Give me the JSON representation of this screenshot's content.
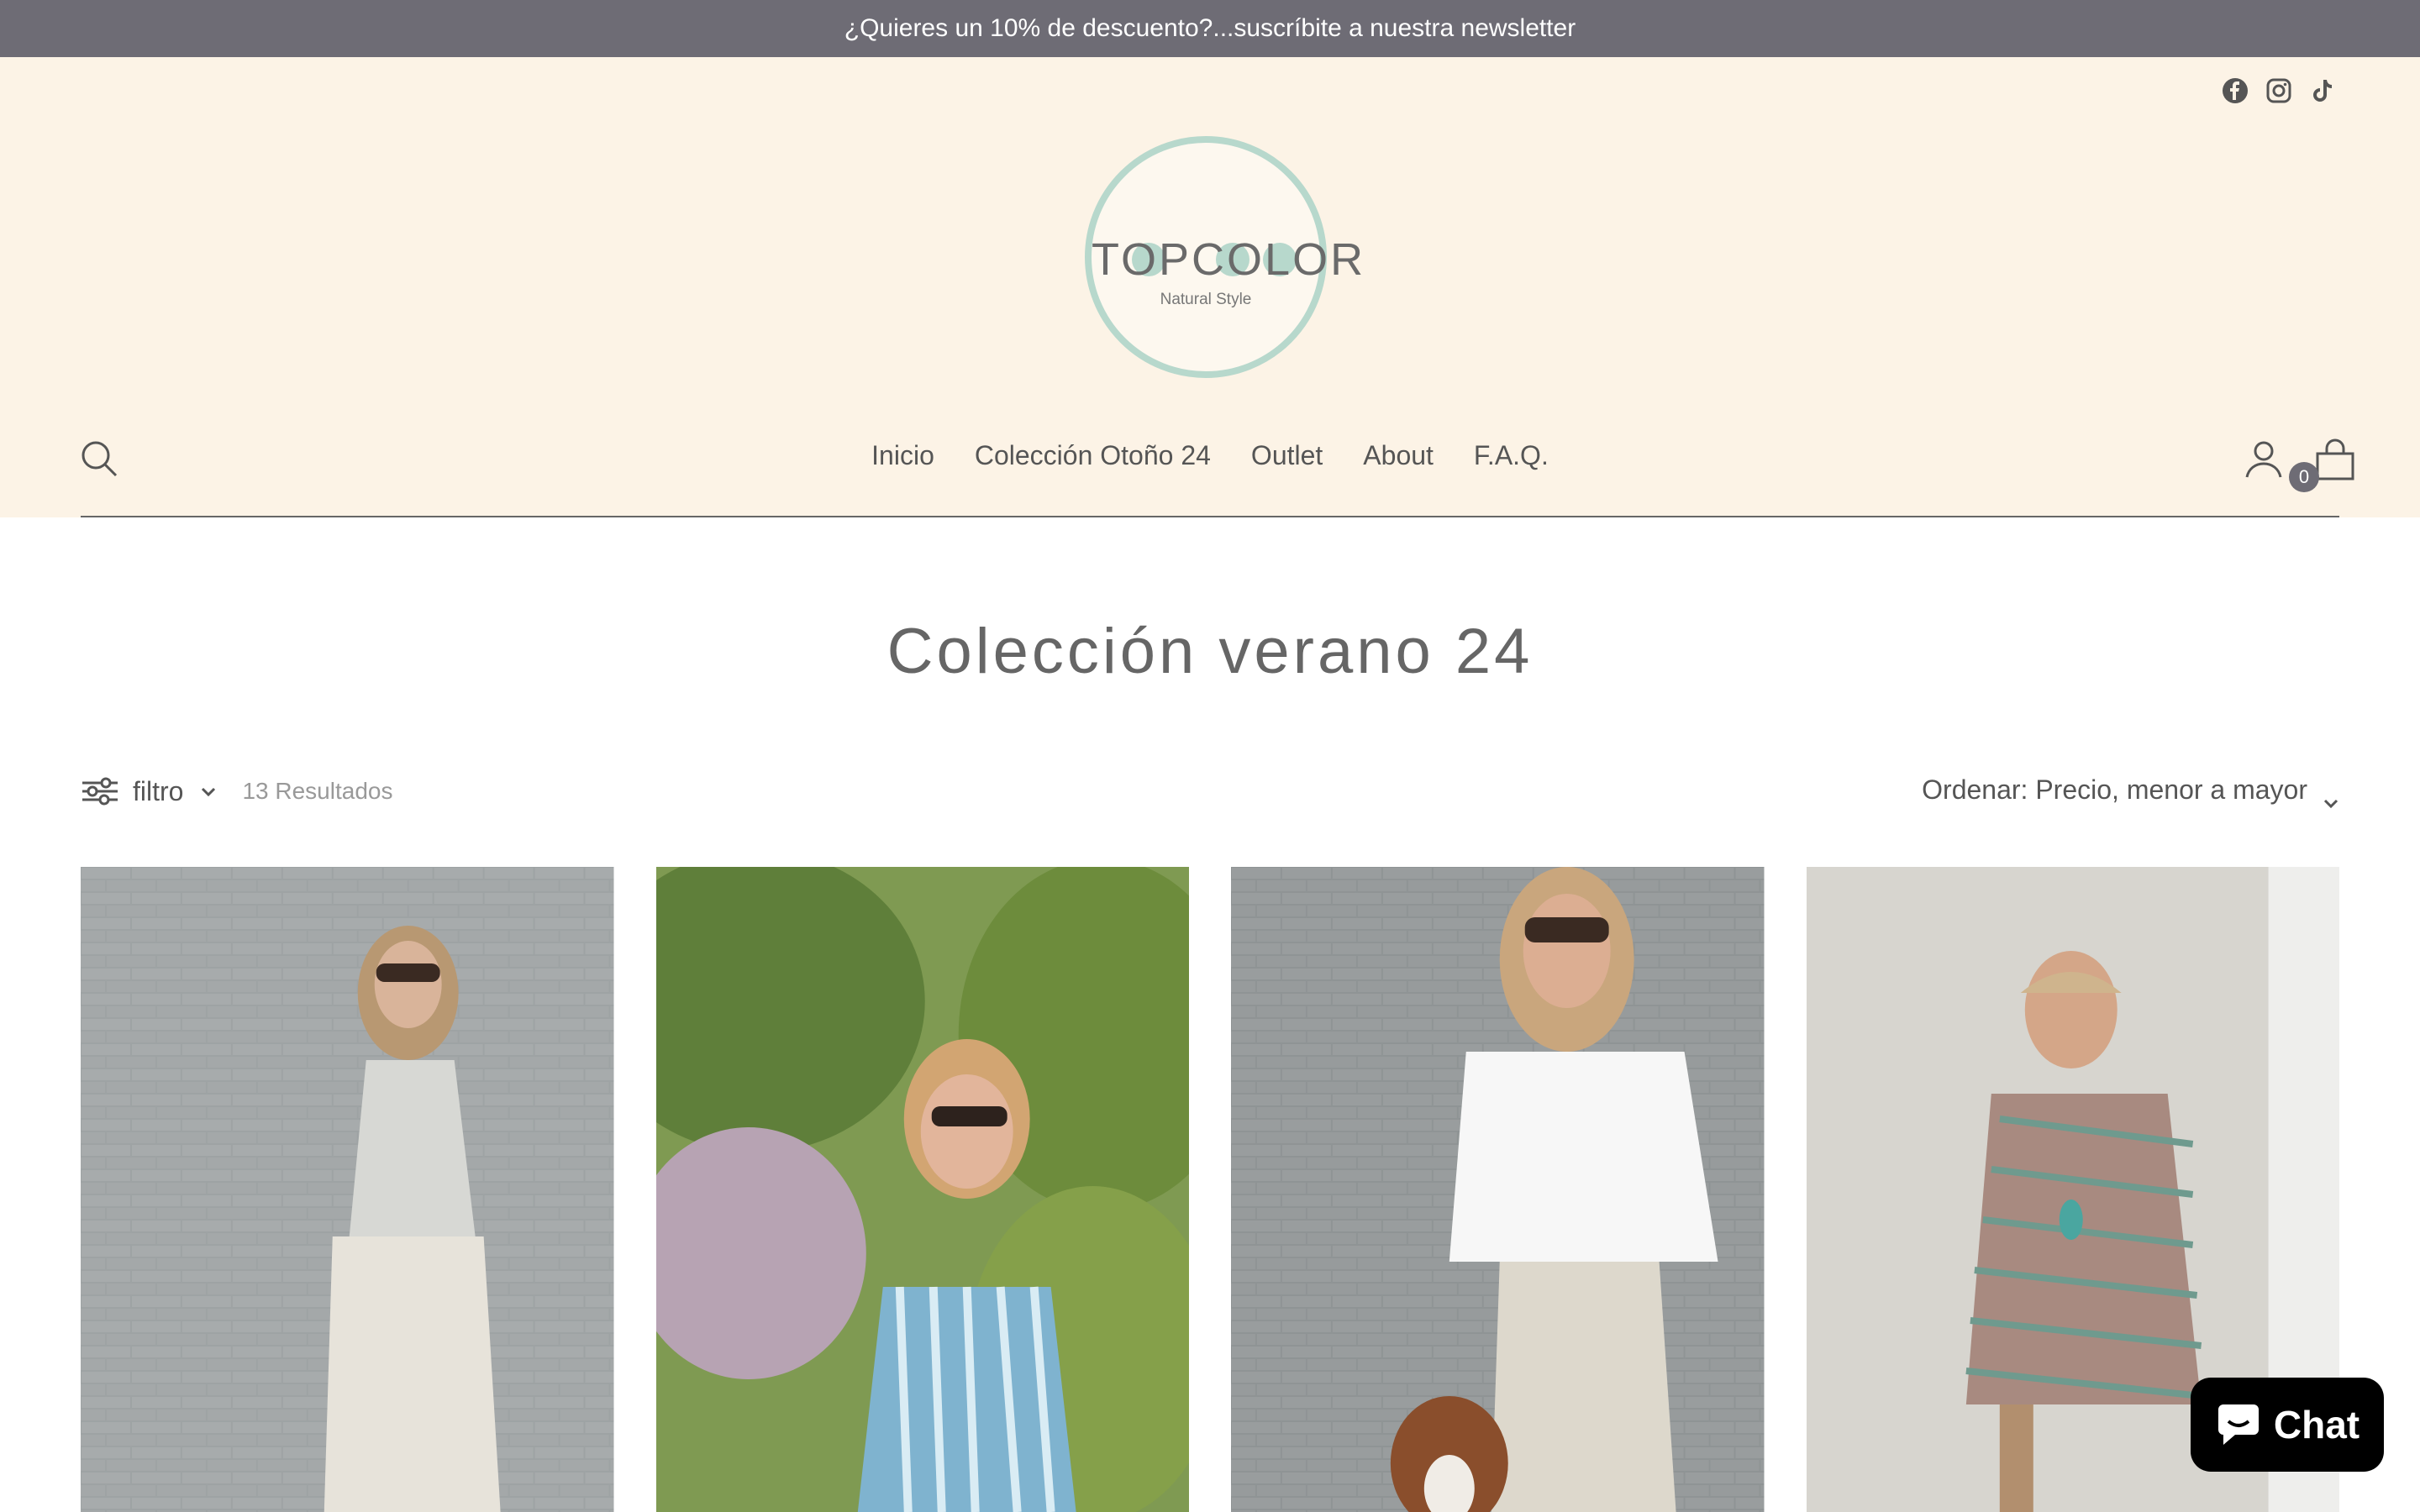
{
  "announcement": "¿Quieres un 10% de descuento?...suscríbite a nuestra newsletter",
  "socials": [
    "facebook-icon",
    "instagram-icon",
    "tiktok-icon"
  ],
  "brand": {
    "name": "TOPCOLOR",
    "tagline": "Natural Style",
    "accent": "#b7d8cc"
  },
  "nav": {
    "items": [
      "Inicio",
      "Colección Otoño 24",
      "Outlet",
      "About",
      "F.A.Q."
    ]
  },
  "cart": {
    "count": "0"
  },
  "collection": {
    "title": "Colección verano 24",
    "filter_label": "filtro",
    "results": "13 Resultados",
    "sort_label": "Ordenar: Precio, menor a mayor"
  },
  "chat": {
    "label": "Chat"
  },
  "colors": {
    "announcement_bg": "#6e6c75",
    "header_bg": "#fcf3e6"
  }
}
